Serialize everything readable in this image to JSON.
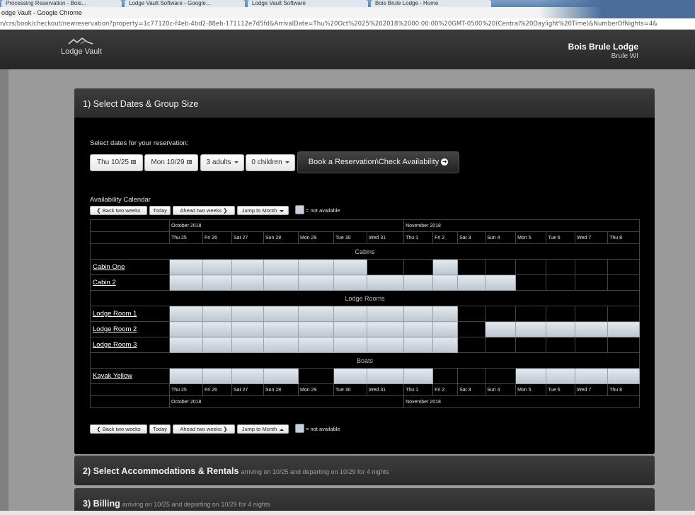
{
  "browser": {
    "tabs": [
      "Processing Reservation - Bois...",
      "Lodge Vault Software - Google...",
      "Lodge Vault Software",
      "Bois Brule Lodge - Home"
    ],
    "window_title": "odge Vault - Google Chrome",
    "url": "n/crs/book/checkout/newreservation?property=1c77120c-f4eb-4bd2-88eb-171112e7d5fd&ArrivalDate=Thu%20Oct%2025%202018%2000:00:00%20GMT-0500%20(Central%20Daylight%20Time)&NumberOfNights=4&"
  },
  "header": {
    "logo_text": "Lodge Vault",
    "lodge_name": "Bois Brule Lodge",
    "lodge_location": "Brule WI"
  },
  "step1": {
    "title": "1) Select Dates & Group Size",
    "select_dates_label": "Select dates for your reservation:",
    "arrival_date": "Thu 10/25",
    "departure_date": "Mon 10/29",
    "adults": "3 adults",
    "children": "0 children",
    "book_button": "Book a Reservation\\Check Availability",
    "availability_label": "Availability Calendar",
    "nav": {
      "back": "Back two weeks",
      "today": "Today",
      "ahead": "Ahead two weeks",
      "jump": "Jump to Month"
    },
    "legend": "= not available"
  },
  "calendar": {
    "months": [
      {
        "label": "October 2018",
        "span": 7
      },
      {
        "label": "November 2018",
        "span": 8
      }
    ],
    "days": [
      "Thu 25",
      "Fri 26",
      "Sat 27",
      "Sun 28",
      "Mon 29",
      "Tue 30",
      "Wed 31",
      "Thu 1",
      "Fri 2",
      "Sat 3",
      "Sun 4",
      "Mon 5",
      "Tue 6",
      "Wed 7",
      "Thu 8"
    ],
    "sections": [
      {
        "name": "Cabins",
        "units": [
          {
            "name": "Cabin One",
            "unavailable": [
              1,
              1,
              1,
              1,
              1,
              1,
              0,
              0,
              1,
              0,
              0,
              0,
              0,
              0,
              0
            ]
          },
          {
            "name": "Cabin 2",
            "unavailable": [
              1,
              1,
              1,
              1,
              1,
              1,
              1,
              1,
              1,
              1,
              1,
              0,
              0,
              0,
              0
            ]
          }
        ]
      },
      {
        "name": "Lodge Rooms",
        "units": [
          {
            "name": "Lodge Room 1",
            "unavailable": [
              1,
              1,
              1,
              1,
              1,
              1,
              1,
              1,
              1,
              0,
              0,
              0,
              0,
              0,
              0
            ]
          },
          {
            "name": "Lodge Room 2",
            "unavailable": [
              1,
              1,
              1,
              1,
              1,
              1,
              1,
              1,
              1,
              0,
              1,
              1,
              1,
              1,
              1
            ]
          },
          {
            "name": "Lodge Room 3",
            "unavailable": [
              1,
              1,
              1,
              1,
              1,
              1,
              1,
              1,
              1,
              0,
              0,
              0,
              0,
              0,
              0
            ]
          }
        ]
      },
      {
        "name": "Boats",
        "units": [
          {
            "name": "Kayak Yellow",
            "unavailable": [
              1,
              1,
              1,
              1,
              0,
              1,
              1,
              1,
              0,
              0,
              0,
              1,
              1,
              1,
              1
            ]
          }
        ]
      }
    ]
  },
  "step2": {
    "title": "2) Select Accommodations & Rentals",
    "subtitle": "arriving on 10/25 and departing on 10/29 for 4 nights"
  },
  "step3": {
    "title": "3) Billing",
    "subtitle": "arriving on 10/25 and departing on 10/29 for 4 nights"
  }
}
